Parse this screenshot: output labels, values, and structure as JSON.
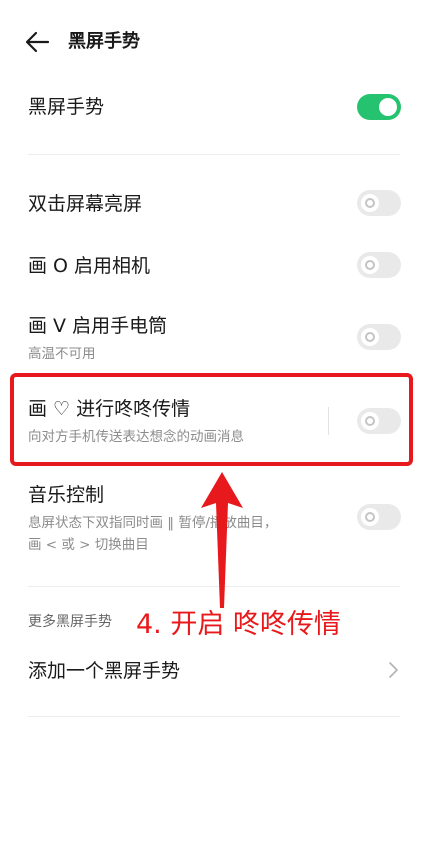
{
  "header": {
    "title": "黑屏手势",
    "back_icon": "arrow-left-icon"
  },
  "master": {
    "title": "黑屏手势",
    "enabled": true
  },
  "gestures": [
    {
      "title": "双击屏幕亮屏",
      "subtitle": "",
      "enabled": false
    },
    {
      "title": "画 O 启用相机",
      "subtitle": "",
      "enabled": false
    },
    {
      "title": "画 V 启用手电筒",
      "subtitle": "高温不可用",
      "enabled": false
    },
    {
      "title": "画 ♡ 进行咚咚传情",
      "subtitle": "向对方手机传送表达想念的动画消息",
      "enabled": false
    },
    {
      "title": "音乐控制",
      "subtitle_line1": "息屏状态下双指同时画 ‖ 暂停/播放曲目，",
      "subtitle_line2": "画 < 或 > 切换曲目",
      "enabled": false
    }
  ],
  "more": {
    "section_label": "更多黑屏手势",
    "add_label": "添加一个黑屏手势",
    "chevron_icon": "chevron-right-icon"
  },
  "annotation": {
    "text": "4. 开启 咚咚传情",
    "color": "#e8191c"
  },
  "colors": {
    "toggle_on": "#25c36f",
    "toggle_off": "#e9e9e9",
    "annotation_red": "#e8191c"
  }
}
